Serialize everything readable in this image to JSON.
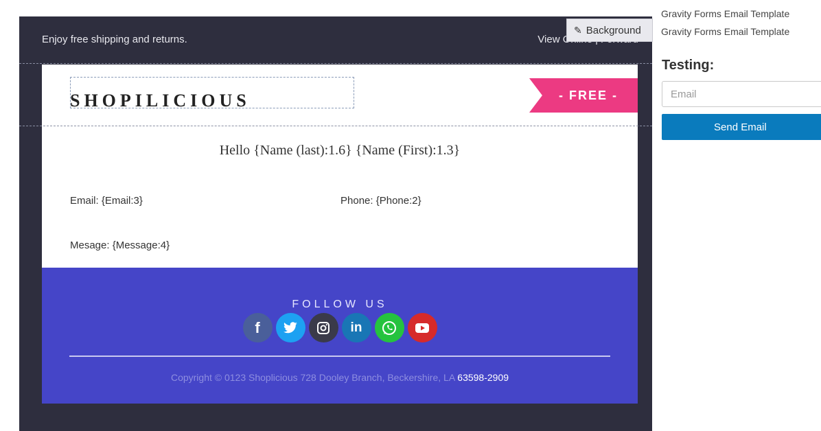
{
  "email_preview": {
    "top_bar_text": "Enjoy free shipping and returns.",
    "top_links": [
      "View Online",
      "Forward"
    ],
    "background_tool": {
      "label": "Background",
      "icon": "pencil-icon"
    },
    "logo_text": "SHOPILICIOUS",
    "ribbon_text": "- FREE -",
    "greeting": "Hello {Name (last):1.6} {Name (First):1.3}",
    "fields": {
      "email": "Email: {Email:3}",
      "phone": "Phone: {Phone:2}",
      "message": "Mesage: {Message:4}"
    },
    "footer": {
      "follow_label": "FOLLOW US",
      "social_icons": [
        "facebook-icon",
        "twitter-icon",
        "instagram-icon",
        "linkedin-icon",
        "whatsapp-icon",
        "youtube-icon"
      ],
      "copyright": "Copyright © 0123 Shoplicious 728 Dooley Branch, Beckershire, LA ",
      "copyright_phone": "63598-2909"
    }
  },
  "sidebar": {
    "template_items": [
      "Gravity Forms Email Template",
      "Gravity Forms Email Template"
    ],
    "testing_label": "Testing:",
    "email_placeholder": "Email",
    "send_button": "Send Email"
  },
  "colors": {
    "canvas_bg": "#2e2e3e",
    "ribbon": "#ec3a82",
    "footer_bg": "#4545c8",
    "button": "#0a7bbd"
  }
}
